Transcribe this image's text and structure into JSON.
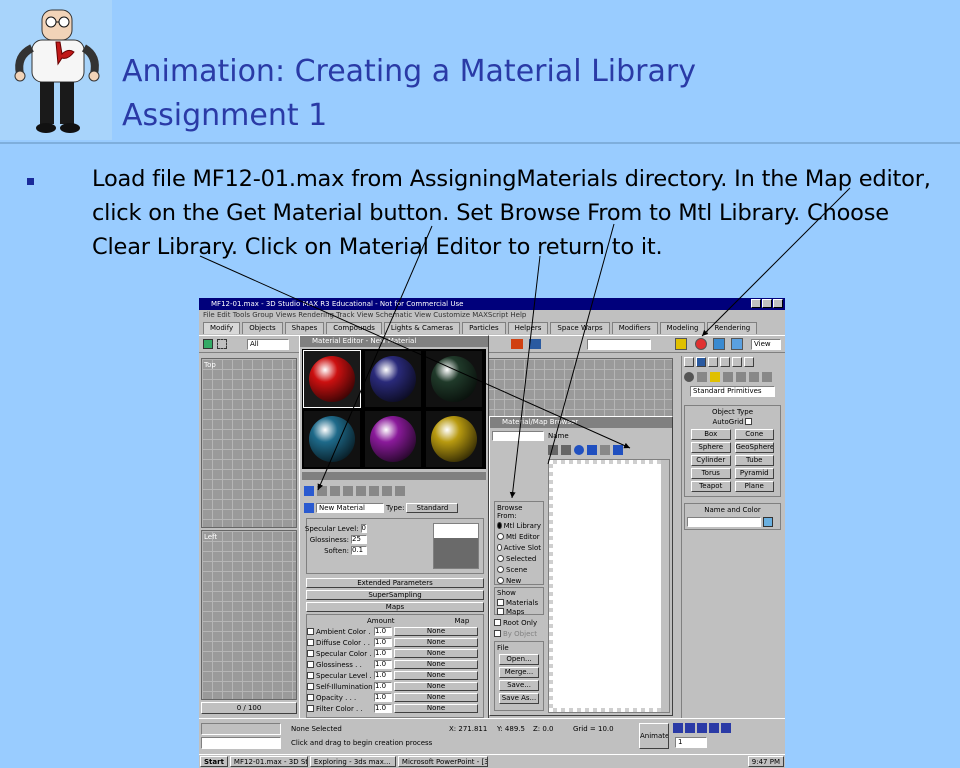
{
  "slide": {
    "title_line1": "Animation: Creating a Material Library",
    "title_line2": "Assignment 1",
    "bullet": "Load file MF12-01.max from AssigningMaterials directory. In the Map editor, click on the Get Material button. Set Browse From to Mtl Library. Choose Clear Library. Click on Material Editor to return to it."
  },
  "colors": {
    "background": "#99ccff",
    "title": "#2a3aa6",
    "bullet_marker": "#1a2a9a"
  },
  "icons": [
    "dilbert-mascot-icon",
    "bullet-square-icon"
  ],
  "app": {
    "window_title": "MF12-01.max - 3D Studio MAX R3 Educational - Not for Commercial Use",
    "menubar": "File  Edit  Tools  Group  Views  Rendering  Track View  Schematic View  Customize  MAXScript  Help",
    "tabs": [
      "Modify",
      "Objects",
      "Shapes",
      "Compounds",
      "Lights & Cameras",
      "Particles",
      "Helpers",
      "Space Warps",
      "Modifiers",
      "Modeling",
      "Rendering"
    ],
    "selection_filter": "All",
    "view_dropdown": "View",
    "viewport_top": "Top",
    "viewport_left": "Left",
    "viewport_counter": "0 / 100",
    "material_editor": {
      "title": "Material Editor - New Material",
      "material_name": "New Material",
      "type_label": "Type:",
      "type_value": "Standard",
      "specular_level_label": "Specular Level:",
      "specular_level_value": "0",
      "glossiness_label": "Glossiness:",
      "glossiness_value": "25",
      "soften_label": "Soften:",
      "soften_value": "0.1",
      "rollout_extended": "Extended Parameters",
      "rollout_supersampling": "SuperSampling",
      "rollout_maps": "Maps",
      "maps_col_amount": "Amount",
      "maps_col_map": "Map",
      "maps": [
        {
          "name": "Ambient Color . . .",
          "amount": "1.0",
          "map": "None"
        },
        {
          "name": "Diffuse Color . .",
          "amount": "1.0",
          "map": "None"
        },
        {
          "name": "Specular Color . .",
          "amount": "1.0",
          "map": "None"
        },
        {
          "name": "Glossiness . .",
          "amount": "1.0",
          "map": "None"
        },
        {
          "name": "Specular Level . .",
          "amount": "1.0",
          "map": "None"
        },
        {
          "name": "Self-Illumination . .",
          "amount": "1.0",
          "map": "None"
        },
        {
          "name": "Opacity . . .",
          "amount": "1.0",
          "map": "None"
        },
        {
          "name": "Filter Color . .",
          "amount": "1.0",
          "map": "None"
        }
      ],
      "spheres": [
        "#cc1010",
        "#2a2a7a",
        "#203a2a",
        "#1e6a8a",
        "#8a1a9a",
        "#b89a10"
      ]
    },
    "browser": {
      "title": "Material/Map Browser",
      "name_field": "Name",
      "browse_from_label": "Browse From:",
      "browse_from": [
        "Mtl Library",
        "Mtl Editor",
        "Active Slot",
        "Selected",
        "Scene",
        "New"
      ],
      "show_label": "Show",
      "show": [
        "Materials",
        "Maps"
      ],
      "root_only": "Root Only",
      "by_object": "By Object",
      "file_label": "File",
      "file_buttons": [
        "Open...",
        "Merge...",
        "Save...",
        "Save As..."
      ]
    },
    "command_panel": {
      "dropdown": "Standard Primitives",
      "object_type": "Object Type",
      "autogrid": "AutoGrid",
      "primitives": [
        "Box",
        "Cone",
        "Sphere",
        "GeoSphere",
        "Cylinder",
        "Tube",
        "Torus",
        "Pyramid",
        "Teapot",
        "Plane"
      ],
      "name_and_color": "Name and Color"
    },
    "status": {
      "selected": "None Selected",
      "prompt": "Click and drag to begin creation process",
      "x": "X: 271.811",
      "y": "Y: 489.5",
      "z": "Z: 0.0",
      "grid": "Grid = 10.0",
      "frame": "1",
      "animate": "Animate"
    },
    "taskbar": [
      "Start",
      "MF12-01.max - 3D Stu...",
      "Exploring - 3ds max...",
      "Microsoft PowerPoint - [3..."
    ],
    "clock": "9:47 PM"
  }
}
